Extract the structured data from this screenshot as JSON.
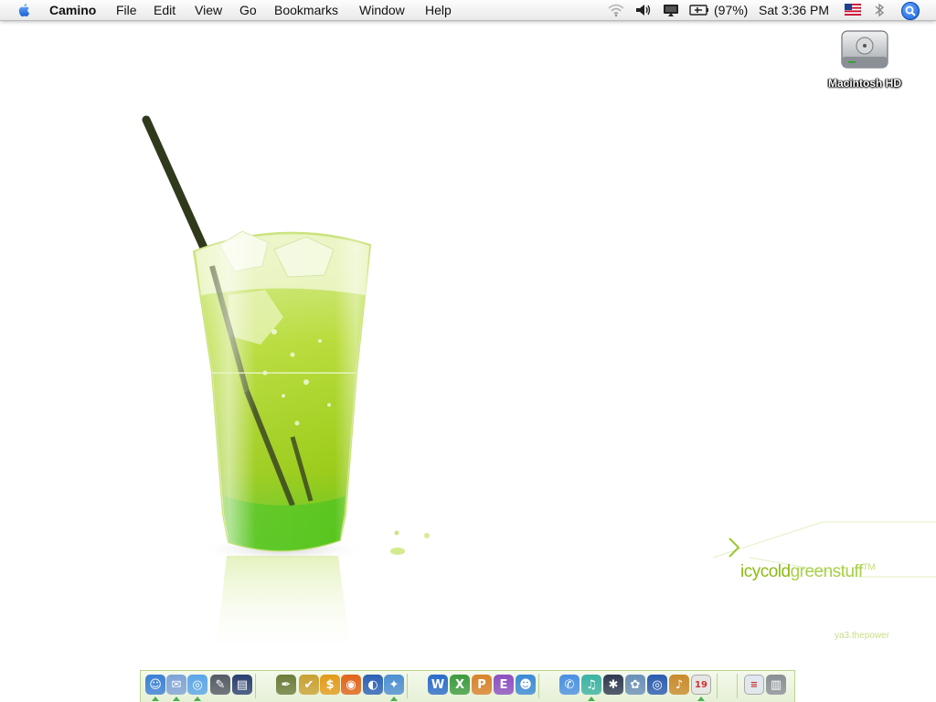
{
  "menubar": {
    "app_name": "Camino",
    "menus": [
      "File",
      "Edit",
      "View",
      "Go",
      "Bookmarks",
      "Window",
      "Help"
    ],
    "battery": "(97%)",
    "clock": "Sat 3:36 PM",
    "status_icons": [
      "wifi-icon",
      "volume-icon",
      "display-icon",
      "battery-icon",
      "us-flag-icon",
      "bluetooth-icon",
      "spotlight-icon"
    ]
  },
  "desktop": {
    "icons": [
      {
        "label": "Macintosh HD",
        "icon": "hard-drive-icon"
      }
    ]
  },
  "wallpaper": {
    "brand_part1": "icycold",
    "brand_part2": "greenstuff",
    "brand_tm": "TM",
    "credit": "ya3.thepower",
    "accent": "#8dbb14"
  },
  "dock": {
    "items": [
      {
        "name": "finder",
        "icon": "finder-icon",
        "color": "#3b7fd6",
        "glyph": "☺",
        "running": true
      },
      {
        "name": "mail",
        "icon": "mail-icon",
        "color": "#7fa3d8",
        "glyph": "✉",
        "running": true
      },
      {
        "name": "safari",
        "icon": "safari-icon",
        "color": "#5aa6e8",
        "glyph": "◎",
        "running": true
      },
      {
        "name": "script-editor",
        "icon": "script-editor-icon",
        "color": "#555a66",
        "glyph": "✎",
        "running": false
      },
      {
        "name": "keynote",
        "icon": "keynote-icon",
        "color": "#2b3f70",
        "glyph": "▤",
        "running": false
      },
      {
        "name": "pen-tool",
        "icon": "pen-tool-icon",
        "color": "#6b7c3a",
        "glyph": "✒",
        "running": false
      },
      {
        "name": "taskpaper",
        "icon": "checklist-icon",
        "color": "#c9a133",
        "glyph": "✔",
        "running": false
      },
      {
        "name": "money",
        "icon": "dollar-icon",
        "color": "#e39b1a",
        "glyph": "$",
        "running": false
      },
      {
        "name": "firefox",
        "icon": "firefox-icon",
        "color": "#e0641a",
        "glyph": "◉",
        "running": false
      },
      {
        "name": "camino",
        "icon": "camino-icon",
        "color": "#2d61b5",
        "glyph": "◐",
        "running": false
      },
      {
        "name": "network-utility",
        "icon": "globe-icon",
        "color": "#4d8fd1",
        "glyph": "✦",
        "running": true
      },
      {
        "name": "word",
        "icon": "word-icon",
        "color": "#2b6cc9",
        "glyph": "W",
        "running": false
      },
      {
        "name": "excel",
        "icon": "excel-icon",
        "color": "#3e9b3e",
        "glyph": "X",
        "running": false
      },
      {
        "name": "powerpoint",
        "icon": "powerpoint-icon",
        "color": "#d9822b",
        "glyph": "P",
        "running": false
      },
      {
        "name": "entourage",
        "icon": "entourage-icon",
        "color": "#8d4fc2",
        "glyph": "E",
        "running": false
      },
      {
        "name": "messenger",
        "icon": "messenger-icon",
        "color": "#3a8ad6",
        "glyph": "☻",
        "running": false
      },
      {
        "name": "ichat",
        "icon": "ichat-icon",
        "color": "#4a90e2",
        "glyph": "✆",
        "running": false
      },
      {
        "name": "itunes",
        "icon": "itunes-icon",
        "color": "#3bb3a3",
        "glyph": "♫",
        "running": true
      },
      {
        "name": "imovie",
        "icon": "imovie-icon",
        "color": "#2f3a52",
        "glyph": "✱",
        "running": false
      },
      {
        "name": "iphoto",
        "icon": "iphoto-icon",
        "color": "#6b8fb8",
        "glyph": "✿",
        "running": false
      },
      {
        "name": "idvd",
        "icon": "idvd-icon",
        "color": "#2b5bb0",
        "glyph": "◎",
        "running": false
      },
      {
        "name": "garageband",
        "icon": "garageband-icon",
        "color": "#c98a2b",
        "glyph": "♪",
        "running": false
      },
      {
        "name": "ical",
        "icon": "calendar-icon",
        "color": "#e5e5e5",
        "glyph": "19",
        "running": true
      },
      {
        "name": "preview",
        "icon": "document-icon",
        "color": "#dfe6ef",
        "glyph": "≡",
        "running": false
      },
      {
        "name": "trash",
        "icon": "trash-icon",
        "color": "#8a8f96",
        "glyph": "▥",
        "running": false
      }
    ]
  }
}
